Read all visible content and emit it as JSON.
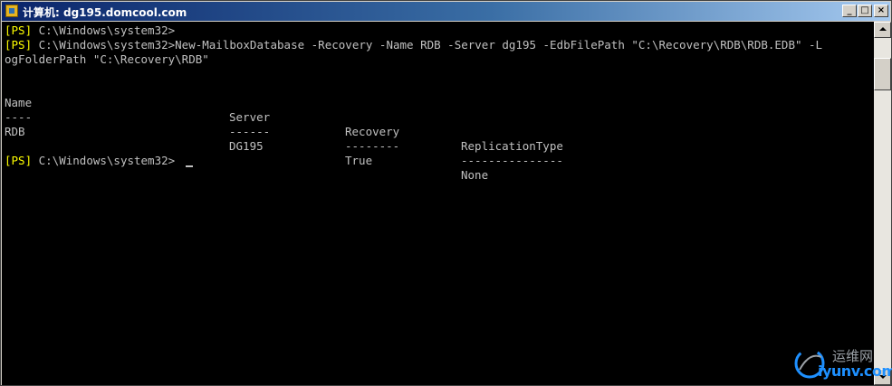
{
  "window": {
    "title": "计算机: dg195.domcool.com",
    "minimize_label": "_",
    "maximize_label": "□",
    "close_label": "×"
  },
  "console": {
    "prompt_tag": "[PS]",
    "lines": [
      {
        "tag": "[PS]",
        "text": " C:\\Windows\\system32>"
      },
      {
        "tag": "[PS]",
        "text": " C:\\Windows\\system32>New-MailboxDatabase -Recovery -Name RDB -Server dg195 -EdbFilePath \"C:\\Recovery\\RDB\\RDB.EDB\" -L"
      },
      {
        "tag": "",
        "text": "ogFolderPath \"C:\\Recovery\\RDB\""
      }
    ],
    "table": {
      "headers": [
        "Name",
        "Server",
        "Recovery",
        "ReplicationType"
      ],
      "underlines": [
        "----",
        "------",
        "--------",
        "---------------"
      ],
      "row": [
        "RDB",
        "DG195",
        "True",
        "None"
      ]
    },
    "final_prompt": {
      "tag": "[PS]",
      "text": " C:\\Windows\\system32>"
    }
  },
  "watermark": {
    "cn_text": "运维网",
    "en_text": "iyunv.com"
  },
  "colors": {
    "console_bg": "#000000",
    "console_fg": "#c0c0c0",
    "prompt_tag": "#ffff00",
    "title_bar": "#0a246a"
  }
}
